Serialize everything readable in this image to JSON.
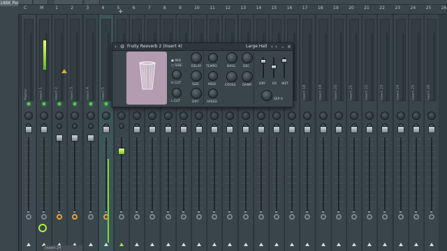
{
  "left_label": "18BK Perc Lo",
  "plugin": {
    "title": "Fruity Reeverb 2",
    "insert": "(Insert 4)",
    "preset": "Large Hall",
    "dot_labels": [
      "MID",
      "SIDE"
    ],
    "knob_labels": [
      "H.CUT",
      "L.CUT",
      "DELAY",
      "TEMPO",
      "SIZE",
      "MOD",
      "DIFF",
      "SPEED",
      "BASS",
      "DEC",
      "CROSS",
      "DAMP"
    ],
    "fader_labels": [
      "DRY",
      "ER",
      "WET"
    ],
    "sep_label": "SEP",
    "sep_value": "0",
    "icons": {
      "arrow": "right-arrow-icon",
      "gear": "gear-icon",
      "prev": "prev-preset-icon",
      "next": "next-preset-icon",
      "minimize": "minimize-icon",
      "close": "close-icon"
    }
  },
  "mixer": {
    "columns": [
      "C",
      "M",
      "1",
      "2",
      "3",
      "4",
      "5",
      "6",
      "7",
      "8",
      "9",
      "10",
      "11",
      "12",
      "13",
      "14",
      "15",
      "16",
      "17",
      "18",
      "19",
      "20",
      "21",
      "22",
      "23",
      "24",
      "25",
      "26",
      "27"
    ],
    "track_names": [
      "Master",
      "Insert 1",
      "Insert 2",
      "Insert 3",
      "Insert 4",
      "Insert 5",
      "Insert 6",
      "Insert 7",
      "Insert 8",
      "Insert 9",
      "Insert 10",
      "Insert 11",
      "Insert 12",
      "Insert 13",
      "Insert 14",
      "Insert 15",
      "Insert 16",
      "Insert 17",
      "Insert 18",
      "Insert 19",
      "Insert 20",
      "Insert 21",
      "Insert 22",
      "Insert 23",
      "Insert 24",
      "Insert 25",
      "Insert 26"
    ],
    "selected_insert": "4",
    "add_symbol": "+",
    "bottom_label": "Insert 24"
  }
}
